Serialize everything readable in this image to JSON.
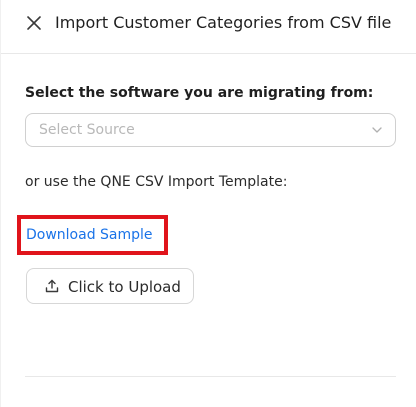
{
  "header": {
    "title": "Import Customer Categories from CSV file",
    "close_icon": "close-icon"
  },
  "form": {
    "software_label": "Select the software you are migrating from:",
    "source_select": {
      "placeholder": "Select Source",
      "icon": "chevron-down-icon"
    },
    "template_text": "or use the QNE CSV Import Template:",
    "download_link": "Download Sample",
    "upload_button": {
      "label": "Click to Upload",
      "icon": "upload-icon"
    }
  },
  "colors": {
    "link": "#1a73e8",
    "highlight": "#e0141b",
    "border": "#d0d0d0",
    "placeholder": "#b8b8b8"
  }
}
